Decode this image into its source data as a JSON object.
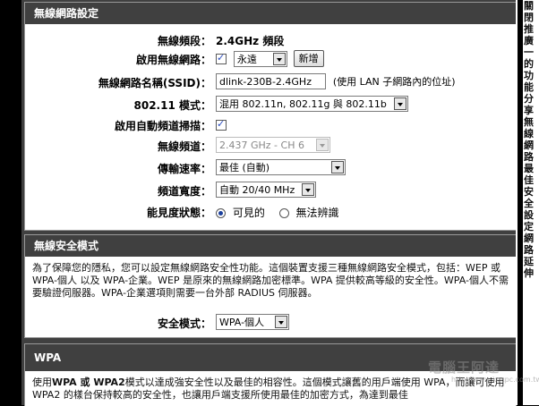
{
  "wireless_settings": {
    "title": "無線網路設定",
    "band_label": "無線頻段：",
    "band_value": "2.4GHz 頻段",
    "enable_label": "啟用無線網路：",
    "enable_schedule": "永遠",
    "new_button": "新增",
    "ssid_label": "無線網路名稱(SSID)：",
    "ssid_value": "dlink-230B-2.4GHz",
    "ssid_hint": "(使用 LAN 子網路內的位址)",
    "mode_label": "802.11 模式：",
    "mode_value": "混用 802.11n, 802.11g 與 802.11b",
    "auto_channel_label": "啟用自動頻道掃描：",
    "channel_label": "無線頻道：",
    "channel_value": "2.437 GHz - CH 6",
    "rate_label": "傳輸速率：",
    "rate_value": "最佳 (自動)",
    "width_label": "頻道寬度：",
    "width_value": "自動 20/40 MHz",
    "visibility_label": "能見度狀態：",
    "visible_option": "可見的",
    "invisible_option": "無法辨識"
  },
  "security_mode": {
    "title": "無線安全模式",
    "description": "為了保障您的隱私，您可以設定無線網路安全性功能。這個裝置支援三種無線網路安全模式，包括：WEP 或 WPA-個人 以及 WPA-企業。WEP 是原來的無線網路加密標準。WPA 提供較高等級的安全性。WPA-個人不需要驗證伺服器。WPA-企業選項則需要一台外部 RADIUS 伺服器。",
    "mode_label": "安全模式：",
    "mode_value": "WPA-個人"
  },
  "wpa": {
    "title": "WPA",
    "description_bold1": "WPA",
    "description_or": " 或 ",
    "description_bold2": "WPA2",
    "description_rest": "模式以達成強安全性以及最佳的相容性。這個模式讓舊的用戶端使用 WPA，而讓可使用 WPA2 的樣台保持較高的安全性，也讓用戶端支援所使用最佳的加密方式，為達到最佳",
    "description_prefix": "使用"
  },
  "right_sidebar": {
    "text": "關閉推廣一的功能分享無線網路最佳安全設定網路延伸"
  },
  "watermark": {
    "text": "電腦王阿達",
    "url": "http://www.kocpc.com.tw"
  }
}
